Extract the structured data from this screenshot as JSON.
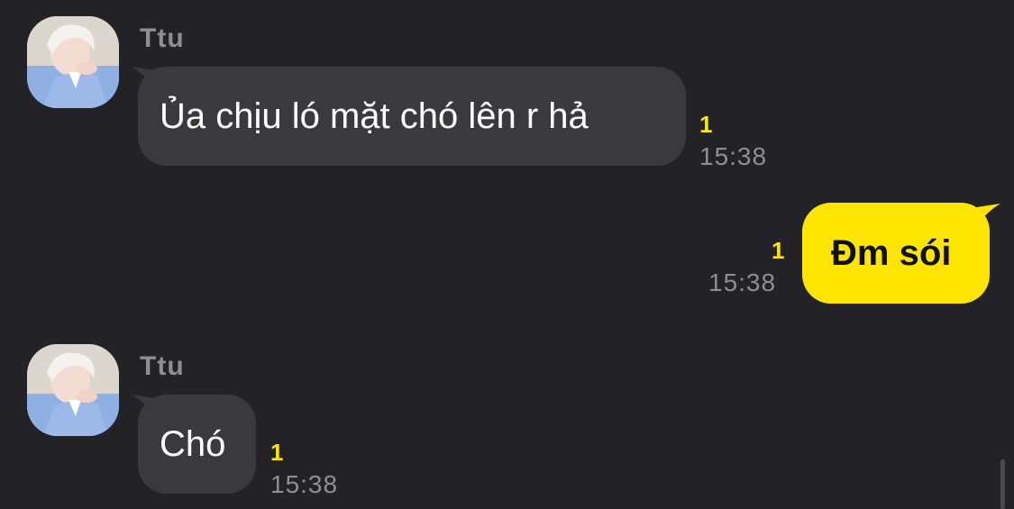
{
  "colors": {
    "background": "#232226",
    "incoming_bubble": "#3a393d",
    "outgoing_bubble": "#fee500",
    "unread_count": "#fee500",
    "secondary_text": "#8e8e93"
  },
  "messages": [
    {
      "direction": "incoming",
      "sender": "Ttu",
      "avatar_icon": "profile-photo",
      "text": "Ủa chịu ló mặt chó lên r hả",
      "unread": "1",
      "time": "15:38"
    },
    {
      "direction": "outgoing",
      "text": "Đm sói",
      "unread": "1",
      "time": "15:38"
    },
    {
      "direction": "incoming",
      "sender": "Ttu",
      "avatar_icon": "profile-photo",
      "text": "Chó",
      "unread": "1",
      "time": "15:38"
    }
  ]
}
